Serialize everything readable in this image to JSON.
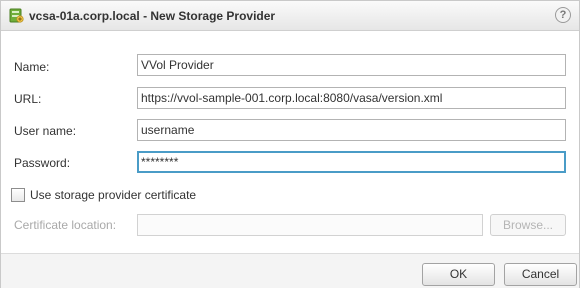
{
  "window": {
    "title": "vcsa-01a.corp.local - New Storage Provider",
    "help": "?"
  },
  "form": {
    "name_label": "Name:",
    "name_value": "VVol Provider",
    "url_label": "URL:",
    "url_value": "https://vvol-sample-001.corp.local:8080/vasa/version.xml",
    "username_label": "User name:",
    "username_value": "username",
    "password_label": "Password:",
    "password_value": "********",
    "cert_checkbox_label": "Use storage provider certificate",
    "cert_checkbox_checked": false,
    "cert_location_label": "Certificate location:",
    "cert_location_value": "",
    "browse_label": "Browse..."
  },
  "footer": {
    "ok_label": "OK",
    "cancel_label": "Cancel"
  },
  "colors": {
    "focus_border": "#4a9cc7",
    "icon_green": "#6fae3a",
    "icon_yellow": "#f0c64a"
  }
}
